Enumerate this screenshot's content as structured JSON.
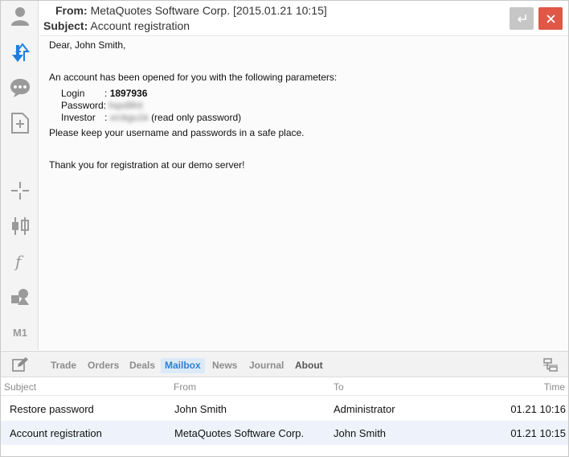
{
  "header": {
    "from_label": "From:",
    "from_value": "MetaQuotes Software Corp. [2015.01.21 10:15]",
    "subject_label": "Subject:",
    "subject_value": "Account registration",
    "reply_icon": "reply-icon",
    "close_icon": "close-icon"
  },
  "message": {
    "greeting": "Dear, John Smith,",
    "intro": "An account has been opened for you with the following parameters:",
    "login_label": "Login",
    "login_sep": ":",
    "login_value": "1897936",
    "password_label": "Password:",
    "password_value": "hqsi8fnt",
    "investor_label": "Investor",
    "investor_sep": ":",
    "investor_value": "xrckgu1k",
    "investor_note": "(read only password)",
    "keep_safe": "Please keep your username and passwords in a safe place.",
    "thanks": "Thank you for registration at our demo server!"
  },
  "sidebar": {
    "items": [
      "account-icon",
      "sync-icon",
      "chat-icon",
      "new-document-icon",
      "crosshair-icon",
      "candlestick-icon",
      "function-icon",
      "shapes-icon",
      "timeframe-icon"
    ],
    "timeframe_label": "M1"
  },
  "tabs": {
    "items": [
      {
        "label": "Trade"
      },
      {
        "label": "Orders"
      },
      {
        "label": "Deals"
      },
      {
        "label": "Mailbox"
      },
      {
        "label": "News"
      },
      {
        "label": "Journal"
      },
      {
        "label": "About"
      }
    ],
    "active": "Mailbox"
  },
  "mailbox": {
    "columns": [
      "Subject",
      "From",
      "To",
      "Time"
    ],
    "rows": [
      {
        "subject": "Restore password",
        "from": "John Smith",
        "to": "Administrator",
        "time": "01.21 10:16"
      },
      {
        "subject": "Account registration",
        "from": "MetaQuotes Software Corp.",
        "to": "John Smith",
        "time": "01.21 10:15"
      }
    ]
  },
  "colors": {
    "accent": "#2e7fd6",
    "close_button": "#e05748",
    "selected_row": "#eef3fb"
  }
}
